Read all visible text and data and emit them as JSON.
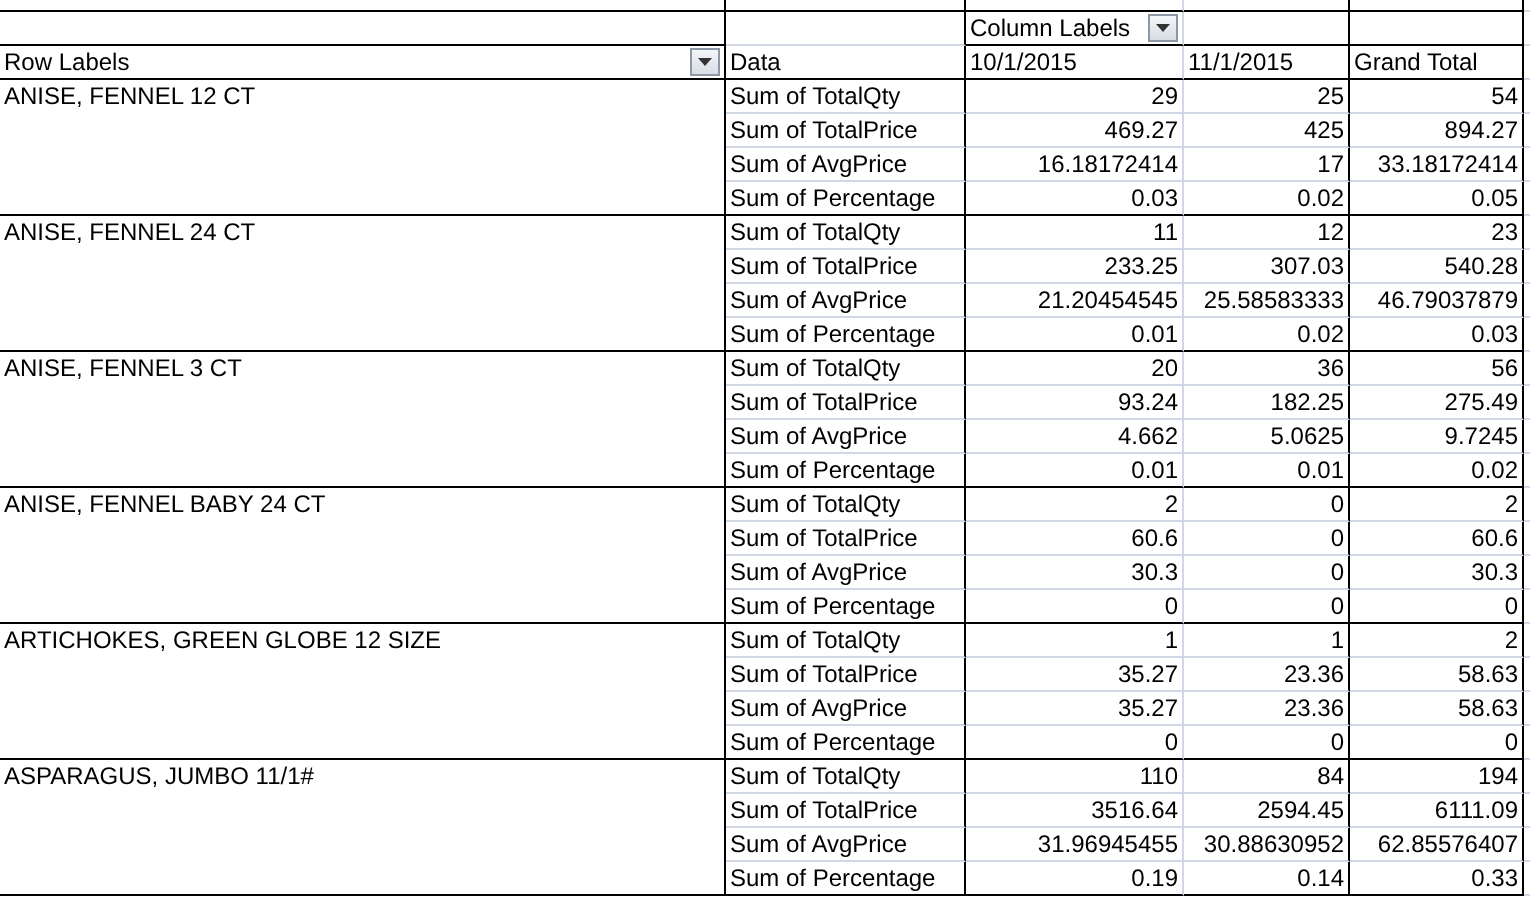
{
  "column_area_label": "Column Labels",
  "row_labels_header": "Row Labels",
  "data_header": "Data",
  "columns": [
    "10/1/2015",
    "11/1/2015",
    "Grand Total"
  ],
  "groups": [
    {
      "label": "ANISE, FENNEL 12 CT",
      "rows": [
        {
          "measure": "Sum of TotalQty",
          "values": [
            "29",
            "25",
            "54"
          ]
        },
        {
          "measure": "Sum of TotalPrice",
          "values": [
            "469.27",
            "425",
            "894.27"
          ]
        },
        {
          "measure": "Sum of AvgPrice",
          "values": [
            "16.18172414",
            "17",
            "33.18172414"
          ]
        },
        {
          "measure": "Sum of Percentage",
          "values": [
            "0.03",
            "0.02",
            "0.05"
          ]
        }
      ]
    },
    {
      "label": "ANISE, FENNEL 24 CT",
      "rows": [
        {
          "measure": "Sum of TotalQty",
          "values": [
            "11",
            "12",
            "23"
          ]
        },
        {
          "measure": "Sum of TotalPrice",
          "values": [
            "233.25",
            "307.03",
            "540.28"
          ]
        },
        {
          "measure": "Sum of AvgPrice",
          "values": [
            "21.20454545",
            "25.58583333",
            "46.79037879"
          ]
        },
        {
          "measure": "Sum of Percentage",
          "values": [
            "0.01",
            "0.02",
            "0.03"
          ]
        }
      ]
    },
    {
      "label": "ANISE, FENNEL 3 CT",
      "rows": [
        {
          "measure": "Sum of TotalQty",
          "values": [
            "20",
            "36",
            "56"
          ]
        },
        {
          "measure": "Sum of TotalPrice",
          "values": [
            "93.24",
            "182.25",
            "275.49"
          ]
        },
        {
          "measure": "Sum of AvgPrice",
          "values": [
            "4.662",
            "5.0625",
            "9.7245"
          ]
        },
        {
          "measure": "Sum of Percentage",
          "values": [
            "0.01",
            "0.01",
            "0.02"
          ]
        }
      ]
    },
    {
      "label": "ANISE, FENNEL BABY 24 CT",
      "rows": [
        {
          "measure": "Sum of TotalQty",
          "values": [
            "2",
            "0",
            "2"
          ]
        },
        {
          "measure": "Sum of TotalPrice",
          "values": [
            "60.6",
            "0",
            "60.6"
          ]
        },
        {
          "measure": "Sum of AvgPrice",
          "values": [
            "30.3",
            "0",
            "30.3"
          ]
        },
        {
          "measure": "Sum of Percentage",
          "values": [
            "0",
            "0",
            "0"
          ]
        }
      ]
    },
    {
      "label": "ARTICHOKES, GREEN GLOBE 12 SIZE",
      "rows": [
        {
          "measure": "Sum of TotalQty",
          "values": [
            "1",
            "1",
            "2"
          ]
        },
        {
          "measure": "Sum of TotalPrice",
          "values": [
            "35.27",
            "23.36",
            "58.63"
          ]
        },
        {
          "measure": "Sum of AvgPrice",
          "values": [
            "35.27",
            "23.36",
            "58.63"
          ]
        },
        {
          "measure": "Sum of Percentage",
          "values": [
            "0",
            "0",
            "0"
          ]
        }
      ]
    },
    {
      "label": "ASPARAGUS, JUMBO 11/1#",
      "rows": [
        {
          "measure": "Sum of TotalQty",
          "values": [
            "110",
            "84",
            "194"
          ]
        },
        {
          "measure": "Sum of TotalPrice",
          "values": [
            "3516.64",
            "2594.45",
            "6111.09"
          ]
        },
        {
          "measure": "Sum of AvgPrice",
          "values": [
            "31.96945455",
            "30.88630952",
            "62.85576407"
          ]
        },
        {
          "measure": "Sum of Percentage",
          "values": [
            "0.19",
            "0.14",
            "0.33"
          ]
        }
      ]
    }
  ]
}
